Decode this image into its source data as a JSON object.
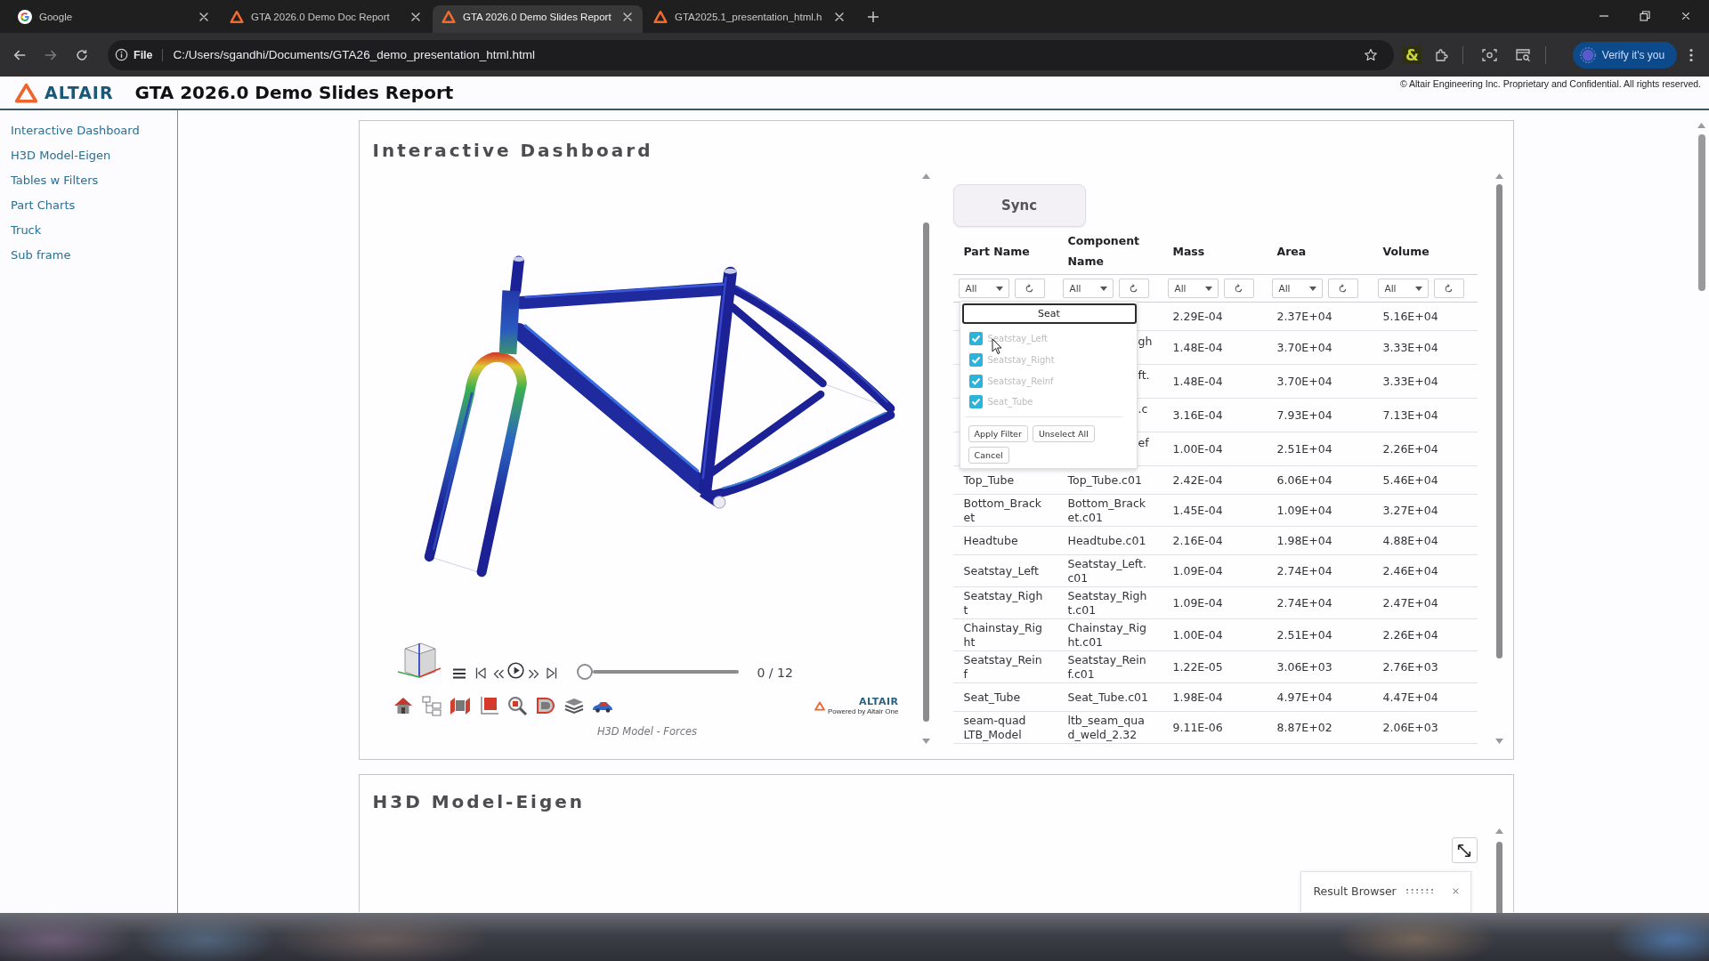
{
  "browser": {
    "tabs": [
      {
        "kind": "google",
        "title": "Google",
        "selected": false
      },
      {
        "kind": "altair",
        "title": "GTA 2026.0 Demo Doc Report",
        "selected": false
      },
      {
        "kind": "altair",
        "title": "GTA 2026.0 Demo Slides Report",
        "selected": true
      },
      {
        "kind": "altair",
        "title": "GTA2025.1_presentation_html.h",
        "selected": false
      }
    ],
    "address_bar": {
      "scheme": "File",
      "url": "C:/Users/sgandhi/Documents/GTA26_demo_presentation_html.html"
    },
    "extension_icon": "&",
    "profile_button": "Verify it's you"
  },
  "header": {
    "logo": "ALTAIR",
    "title": "GTA 2026.0 Demo Slides Report",
    "copyright": "© Altair Engineering Inc. Proprietary and Confidential. All rights reserved."
  },
  "sidebar": {
    "items": [
      "Interactive Dashboard",
      "H3D Model-Eigen",
      "Tables w Filters",
      "Part Charts",
      "Truck",
      "Sub frame"
    ]
  },
  "sections": [
    {
      "title": "Interactive Dashboard",
      "viewer": {
        "frame_counter": "0 / 12",
        "timeline": {
          "level": 0
        },
        "brand": {
          "name": "ALTAIR",
          "tagline": "Powered by Altair One"
        },
        "caption": "H3D Model - Forces"
      },
      "table": {
        "sync_button": "Sync",
        "columns": [
          {
            "label": "Part Name",
            "filter": "All"
          },
          {
            "label": "Component Name",
            "filter": "All"
          },
          {
            "label": "Mass",
            "filter": "All"
          },
          {
            "label": "Area",
            "filter": "All"
          },
          {
            "label": "Volume",
            "filter": "All"
          }
        ],
        "rows": [
          {
            "mass": "2.29E-04",
            "area": "2.37E+04",
            "volume": "5.16E+04"
          },
          {
            "component_name": "gh",
            "mass": "1.48E-04",
            "area": "3.70E+04",
            "volume": "3.33E+04"
          },
          {
            "component_name": "ft.",
            "mass": "1.48E-04",
            "area": "3.70E+04",
            "volume": "3.33E+04"
          },
          {
            "component_name": ".c",
            "mass": "3.16E-04",
            "area": "7.93E+04",
            "volume": "7.13E+04"
          },
          {
            "component_name": "ef",
            "mass": "1.00E-04",
            "area": "2.51E+04",
            "volume": "2.26E+04"
          },
          {
            "part_name": "Top_Tube",
            "component_name": "Top_Tube.c01",
            "mass": "2.42E-04",
            "area": "6.06E+04",
            "volume": "5.46E+04"
          },
          {
            "part_name": "Bottom_Bracket",
            "component_name": "Bottom_Bracket.c01",
            "mass": "1.45E-04",
            "area": "1.09E+04",
            "volume": "3.27E+04"
          },
          {
            "part_name": "Headtube",
            "component_name": "Headtube.c01",
            "mass": "2.16E-04",
            "area": "1.98E+04",
            "volume": "4.88E+04"
          },
          {
            "part_name": "Seatstay_Left",
            "component_name": "Seatstay_Left.c01",
            "mass": "1.09E-04",
            "area": "2.74E+04",
            "volume": "2.46E+04"
          },
          {
            "part_name": "Seatstay_Right",
            "component_name": "Seatstay_Right.c01",
            "mass": "1.09E-04",
            "area": "2.74E+04",
            "volume": "2.47E+04"
          },
          {
            "part_name": "Chainstay_Right",
            "component_name": "Chainstay_Right.c01",
            "mass": "1.00E-04",
            "area": "2.51E+04",
            "volume": "2.26E+04"
          },
          {
            "part_name": "Seatstay_Reinf",
            "component_name": "Seatstay_Reinf.c01",
            "mass": "1.22E-05",
            "area": "3.06E+03",
            "volume": "2.76E+03"
          },
          {
            "part_name": "Seat_Tube",
            "component_name": "Seat_Tube.c01",
            "mass": "1.98E-04",
            "area": "4.97E+04",
            "volume": "4.47E+04"
          },
          {
            "part_name": "seam-quad LTB_Model",
            "component_name": "ltb_seam_quad_weld_2.32",
            "mass": "9.11E-06",
            "area": "8.87E+02",
            "volume": "2.06E+03"
          }
        ],
        "filter_popup": {
          "search": "Seat",
          "options": [
            {
              "label": "Seatstay_Left",
              "checked": true
            },
            {
              "label": "Seatstay_Right",
              "checked": true
            },
            {
              "label": "Seatstay_Reinf",
              "checked": true
            },
            {
              "label": "Seat_Tube",
              "checked": true
            }
          ],
          "buttons": [
            "Apply Filter",
            "Unselect All",
            "Cancel"
          ]
        }
      }
    },
    {
      "title": "H3D Model-Eigen",
      "result_browser": {
        "title": "Result Browser"
      }
    }
  ]
}
